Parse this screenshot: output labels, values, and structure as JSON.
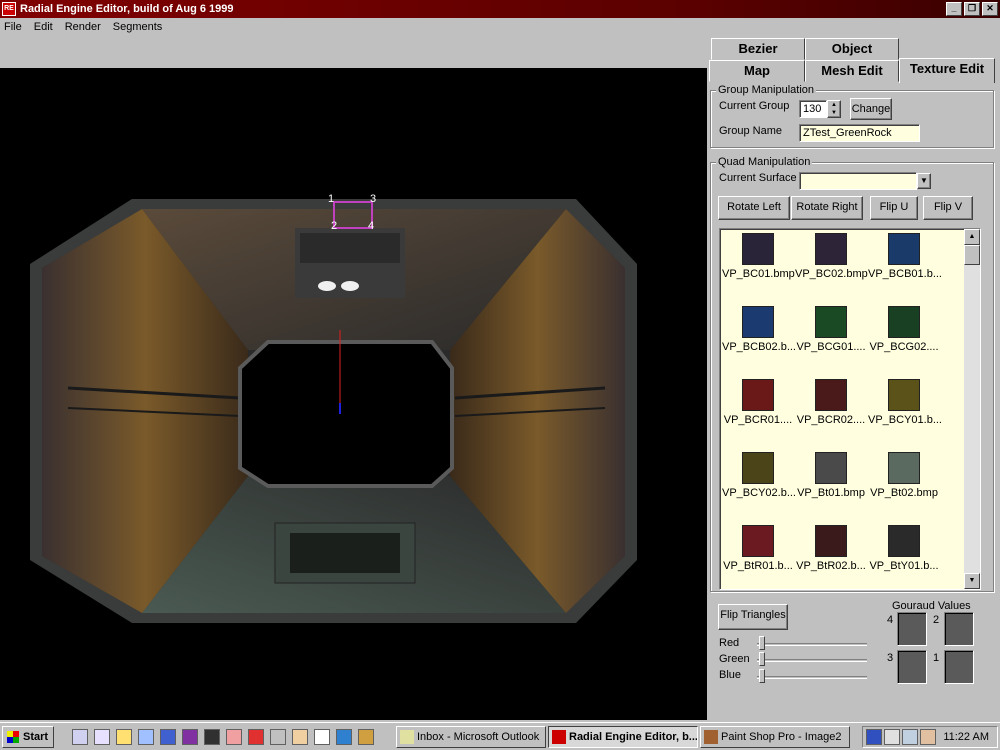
{
  "window": {
    "title": "Radial Engine Editor, build of Aug  6 1999",
    "minimize": "_",
    "restore": "❐",
    "close": "✕",
    "app_icon_text": "RE"
  },
  "menu": [
    "File",
    "Edit",
    "Render",
    "Segments"
  ],
  "tabs": {
    "row1": [
      "Bezier",
      "Object"
    ],
    "row2": [
      "Map",
      "Mesh Edit",
      "Texture Edit"
    ],
    "active": "Texture Edit"
  },
  "group_manipulation": {
    "title": "Group Manipulation",
    "current_group_label": "Current Group",
    "current_group_value": "130",
    "change_button": "Change",
    "group_name_label": "Group Name",
    "group_name_value": "ZTest_GreenRock"
  },
  "quad_manipulation": {
    "title": "Quad Manipulation",
    "current_surface_label": "Current Surface",
    "current_surface_value": "",
    "buttons": [
      "Rotate Left",
      "Rotate Right",
      "Flip U",
      "Flip V"
    ]
  },
  "textures": [
    {
      "name": "VP_BC01.bmp",
      "color": "#2a2438"
    },
    {
      "name": "VP_BC02.bmp",
      "color": "#2e2438"
    },
    {
      "name": "VP_BCB01.b...",
      "color": "#1a3a6a"
    },
    {
      "name": "VP_BCB02.b...",
      "color": "#1a3a70"
    },
    {
      "name": "VP_BCG01....",
      "color": "#1a4a24"
    },
    {
      "name": "VP_BCG02....",
      "color": "#1a4024"
    },
    {
      "name": "VP_BCR01....",
      "color": "#6a1818"
    },
    {
      "name": "VP_BCR02....",
      "color": "#4a1a1a"
    },
    {
      "name": "VP_BCY01.b...",
      "color": "#5a5218"
    },
    {
      "name": "VP_BCY02.b...",
      "color": "#4a4418"
    },
    {
      "name": "VP_Bt01.bmp",
      "color": "#4a4a4a"
    },
    {
      "name": "VP_Bt02.bmp",
      "color": "#5a6a60"
    },
    {
      "name": "VP_BtR01.b...",
      "color": "#6a1a20"
    },
    {
      "name": "VP_BtR02.b...",
      "color": "#3a1a1a"
    },
    {
      "name": "VP_BtY01.b...",
      "color": "#2a2a2a"
    }
  ],
  "flip_triangles": "Flip Triangles",
  "gouraud": {
    "title": "Gouraud Values",
    "labels": [
      "4",
      "2",
      "3",
      "1"
    ]
  },
  "sliders": [
    "Red",
    "Green",
    "Blue"
  ],
  "viewport": {
    "vertex_labels": [
      "1",
      "3",
      "2",
      "4"
    ]
  },
  "taskbar": {
    "start": "Start",
    "tasks": [
      "Inbox - Microsoft Outlook",
      "Radial Engine Editor, b...",
      "Paint Shop Pro - Image2"
    ],
    "clock": "11:22 AM"
  }
}
